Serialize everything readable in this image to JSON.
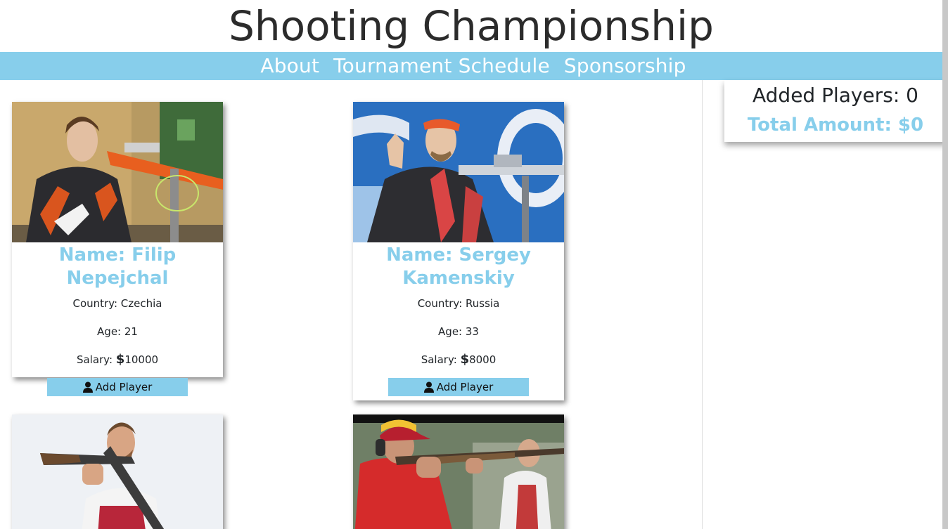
{
  "header": {
    "title": "Shooting Championship"
  },
  "nav": {
    "items": [
      "About",
      "Tournament Schedule",
      "Sponsorship"
    ]
  },
  "summary": {
    "players_label": "Added Players: 0",
    "total_label": "Total Amount: $0"
  },
  "players": [
    {
      "name": "Name: Filip Nepejchal",
      "country": "Country: Czechia",
      "age": "Age: 21",
      "salary_label": "Salary: ",
      "salary_symbol": "$",
      "salary_value": "10000",
      "button": "Add Player"
    },
    {
      "name": "Name: Sergey Kamenskiy",
      "country": "Country: Russia",
      "age": "Age: 33",
      "salary_label": "Salary: ",
      "salary_symbol": "$",
      "salary_value": "8000",
      "button": "Add Player"
    }
  ],
  "colors": {
    "accent": "#87ceeb",
    "nav_text": "#ffffff",
    "title_text": "#2b2b2b"
  },
  "icons": [
    "user-icon"
  ]
}
